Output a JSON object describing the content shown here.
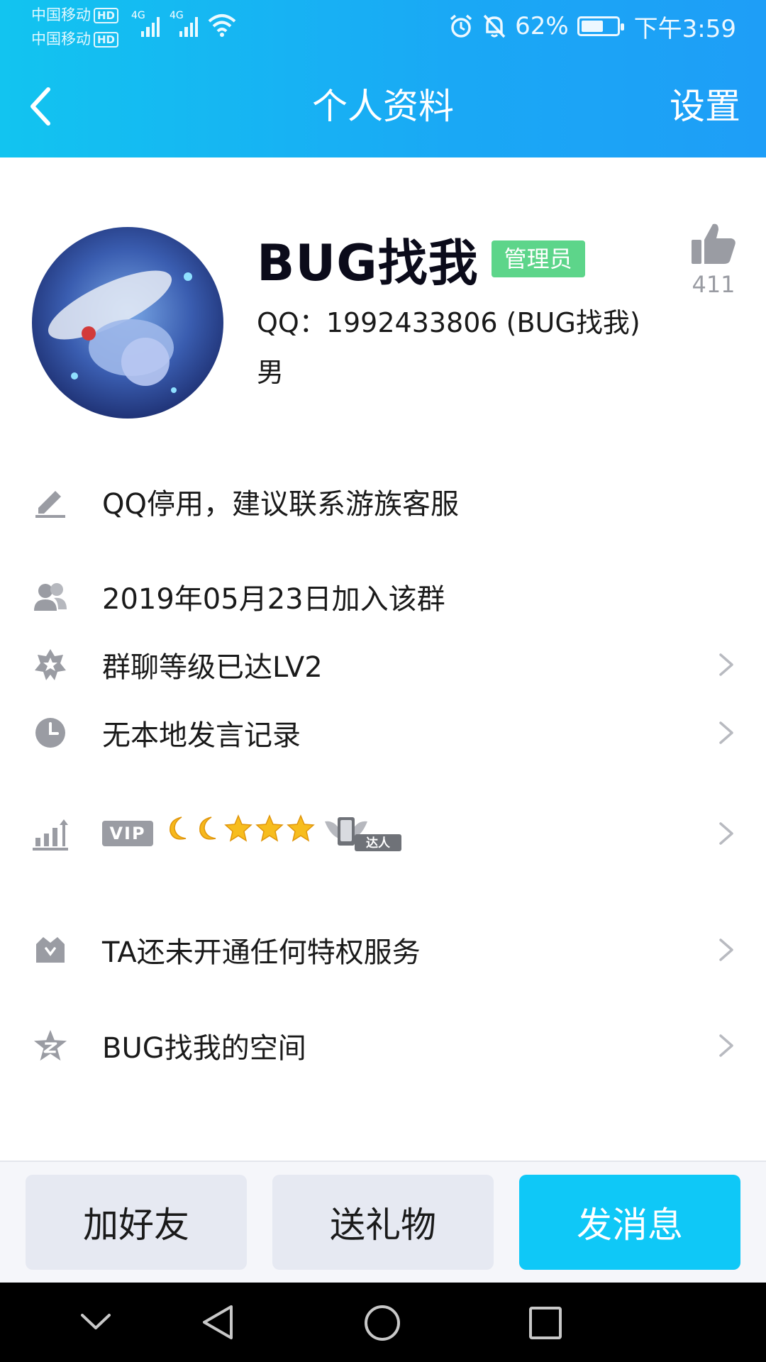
{
  "status_bar": {
    "carrier_1": "中国移动",
    "carrier_2": "中国移动",
    "hd_label": "HD",
    "network_1": "4G",
    "network_2": "4G",
    "battery_percent": "62%",
    "battery_level": 0.62,
    "time": "下午3:59"
  },
  "nav": {
    "title": "个人资料",
    "settings_label": "设置"
  },
  "profile": {
    "name": "BUG找我",
    "role_badge": "管理员",
    "qq_line": "QQ：1992433806 (BUG找我)",
    "gender": "男",
    "like_count": "411"
  },
  "rows": {
    "signature": "QQ停用，建议联系游族客服",
    "join_date": "2019年05月23日加入该群",
    "group_level": "群聊等级已达LV2",
    "speech_record": "无本地发言记录",
    "vip_label": "VIP",
    "talent_label": "达人",
    "privilege": "TA还未开通任何特权服务",
    "space": "BUG找我的空间"
  },
  "actions": {
    "add_friend": "加好友",
    "send_gift": "送礼物",
    "send_message": "发消息"
  },
  "colors": {
    "header_gradient_start": "#12c4f0",
    "header_gradient_end": "#1e9ef7",
    "admin_badge": "#5dd58a",
    "primary_button": "#0fc8f7",
    "icon_gray": "#9a9ca3"
  }
}
